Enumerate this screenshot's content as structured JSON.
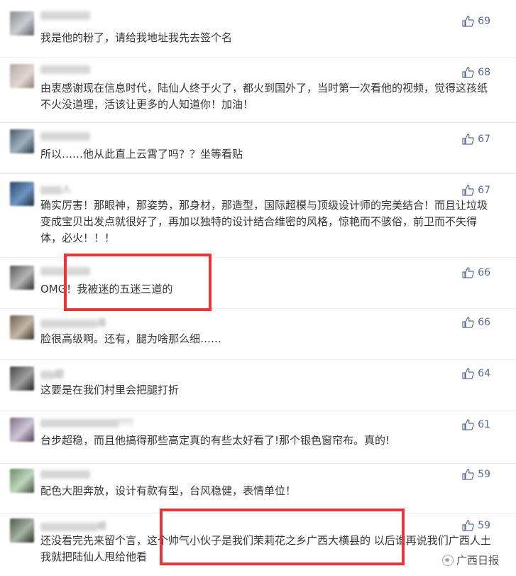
{
  "comments": [
    {
      "nickname": "",
      "text": "我是他的粉了，请给我地址我先去签个名",
      "likes": "69"
    },
    {
      "nickname": "",
      "text": "由衷感谢现在信息时代，陆仙人终于火了，都火到国外了，当时第一次看他的视频，觉得这孩纸不火没道理，活该让更多的人知道你！加油！",
      "likes": "68"
    },
    {
      "nickname": "",
      "text": "所以……他从此直上云霄了吗？？坐等看贴",
      "likes": "67"
    },
    {
      "nickname": "人",
      "text": "确实厉害！那眼神，那姿势，那身材，那造型，国际超模与顶级设计师的完美结合！而且让垃圾变成宝贝出发点就很好了，再加以独特的设计结合维密的风格，惊艳而不骇俗，前卫而不失得体，必火！！！",
      "likes": "67"
    },
    {
      "nickname": "",
      "text": "OMG！我被迷的五迷三道的",
      "likes": "66"
    },
    {
      "nickname": "孩",
      "text": "脸很高级啊。还有，腿为啥那么细……",
      "likes": "66"
    },
    {
      "nickname": "超",
      "text": "这要是在我们村里会把腿打折",
      "likes": "64"
    },
    {
      "nickname": "!!!!",
      "text": "台步超稳，而且他搞得那些高定真的有些太好看了!那个银色窗帘布。真的!",
      "likes": "61"
    },
    {
      "nickname": "",
      "text": "配色大胆奔放，设计有款有型，台风稳健，表情单位！",
      "likes": "59"
    },
    {
      "nickname": "娅",
      "text": "还没看完先来留个言，这个帅气小伙子是我们茉莉花之乡广西大横县的 以后谁再说我们广西人土我就把陆仙人甩给他看",
      "likes": "59"
    }
  ],
  "watermark": {
    "label": "广西日报"
  },
  "icons": {
    "like": "thumbs-up-icon",
    "watermark_logo": "wechat-logo-icon"
  },
  "colors": {
    "likes": "#576b95",
    "highlight": "#e8353a",
    "text": "#353535"
  }
}
